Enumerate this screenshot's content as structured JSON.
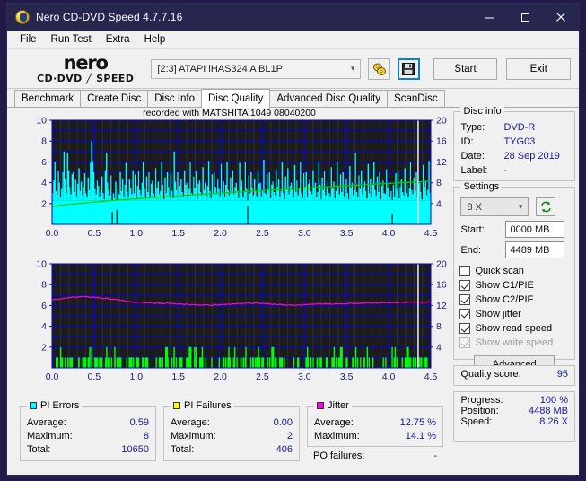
{
  "window": {
    "title": "Nero CD-DVD Speed 4.7.7.16",
    "icon": "nero-disc-icon",
    "minimize": "minimize-icon",
    "maximize": "maximize-icon",
    "close": "close-icon"
  },
  "menu": {
    "items": [
      "File",
      "Run Test",
      "Extra",
      "Help"
    ]
  },
  "toolbar": {
    "logo_line1": "nero",
    "logo_line2": "CD·DVD ╱ SPEED",
    "drive": "[2:3]   ATAPI iHAS324   A BL1P",
    "drive_arrow": "chevron-down-icon",
    "icon_speed": "disc-speed-icon",
    "icon_save": "save-floppy-icon",
    "start_label": "Start",
    "exit_label": "Exit"
  },
  "tabs": [
    {
      "label": "Benchmark",
      "active": false
    },
    {
      "label": "Create Disc",
      "active": false
    },
    {
      "label": "Disc Info",
      "active": false
    },
    {
      "label": "Disc Quality",
      "active": true
    },
    {
      "label": "Advanced Disc Quality",
      "active": false
    },
    {
      "label": "ScanDisc",
      "active": false
    }
  ],
  "chart_header": "recorded with MATSHITA 1049 08040200",
  "disc_info": {
    "legend": "Disc info",
    "rows": [
      {
        "k": "Type:",
        "v": "DVD-R"
      },
      {
        "k": "ID:",
        "v": "TYG03"
      },
      {
        "k": "Date:",
        "v": "28 Sep 2019"
      },
      {
        "k": "Label:",
        "v": "-"
      }
    ]
  },
  "settings": {
    "legend": "Settings",
    "speed": "8 X",
    "speed_arrow": "chevron-down-icon",
    "refresh_icon": "refresh-icon",
    "start_label": "Start:",
    "start_value": "0000 MB",
    "end_label": "End:",
    "end_value": "4489 MB",
    "checkboxes": [
      {
        "label": "Quick scan",
        "checked": false,
        "disabled": false
      },
      {
        "label": "Show C1/PIE",
        "checked": true,
        "disabled": false
      },
      {
        "label": "Show C2/PIF",
        "checked": true,
        "disabled": false
      },
      {
        "label": "Show jitter",
        "checked": true,
        "disabled": false
      },
      {
        "label": "Show read speed",
        "checked": true,
        "disabled": false
      },
      {
        "label": "Show write speed",
        "checked": true,
        "disabled": true
      }
    ],
    "advanced_label": "Advanced"
  },
  "quality": {
    "label": "Quality score:",
    "value": "95"
  },
  "progress": {
    "rows": [
      {
        "k": "Progress:",
        "v": "100 %"
      },
      {
        "k": "Position:",
        "v": "4488 MB"
      },
      {
        "k": "Speed:",
        "v": "8.26 X"
      }
    ]
  },
  "stats": {
    "pi_errors": {
      "legend": "PI Errors",
      "color": "#00ffff",
      "rows": [
        {
          "k": "Average:",
          "v": "0.59"
        },
        {
          "k": "Maximum:",
          "v": "8"
        },
        {
          "k": "Total:",
          "v": "10650"
        }
      ]
    },
    "pi_failures": {
      "legend": "PI Failures",
      "color": "#ffff00",
      "rows": [
        {
          "k": "Average:",
          "v": "0.00"
        },
        {
          "k": "Maximum:",
          "v": "2"
        },
        {
          "k": "Total:",
          "v": "406"
        }
      ]
    },
    "jitter": {
      "legend": "Jitter",
      "color": "#ff00dd",
      "rows": [
        {
          "k": "Average:",
          "v": "12.75 %"
        },
        {
          "k": "Maximum:",
          "v": "14.1 %"
        }
      ],
      "po_label": "PO failures:",
      "po_value": "-"
    }
  },
  "chart_data": [
    {
      "id": "pie-chart",
      "type": "line",
      "title": "recorded with MATSHITA 1049 08040200",
      "xlabel": "",
      "ylabel": "",
      "xlim": [
        0.0,
        4.5
      ],
      "xticks": [
        "0.0",
        "0.5",
        "1.0",
        "1.5",
        "2.0",
        "2.5",
        "3.0",
        "3.5",
        "4.0",
        "4.5"
      ],
      "ylim_left": [
        0,
        10
      ],
      "yticks_left": [
        "2",
        "4",
        "6",
        "8",
        "10"
      ],
      "ylim_right": [
        0,
        20
      ],
      "yticks_right": [
        "4",
        "8",
        "12",
        "16",
        "20"
      ],
      "grid": true,
      "background": "#1c1c1c",
      "grid_color": "#0000ee",
      "series": [
        {
          "name": "PI Errors",
          "color": "#00ffff",
          "axis": "left",
          "style": "filled-spikes",
          "baseline": 2.3,
          "average": 0.59,
          "maximum": 8,
          "total": 10650,
          "values": [
            3.0,
            4.2,
            6.0,
            3.2,
            2.8,
            5.1,
            4.0,
            2.6,
            3.4,
            5.0,
            7.0,
            4.4,
            3.0,
            6.9,
            5.2,
            3.6,
            2.9,
            4.8,
            5.0,
            3.1,
            4.3,
            2.7,
            3.9,
            5.4,
            3.2,
            4.1,
            2.8,
            3.6,
            4.9,
            3.0,
            2.6,
            4.5,
            3.3,
            5.9,
            8.0,
            6.1,
            5.0,
            3.4,
            2.9,
            4.2,
            3.7,
            2.6,
            3.1,
            4.6,
            3.0,
            2.4,
            5.2,
            6.9,
            4.0,
            3.3,
            2.8,
            4.7,
            1.2,
            3.0,
            2.5,
            4.1,
            1.4,
            3.6,
            2.9,
            5.0,
            3.2,
            4.4,
            2.7,
            3.8,
            5.9,
            3.1,
            2.6,
            4.3,
            3.5,
            2.9,
            5.2,
            3.0,
            4.8,
            2.4,
            3.7,
            5.1,
            3.3,
            2.8,
            4.0,
            6.0,
            3.4,
            2.5,
            4.6,
            3.1,
            5.0,
            2.7,
            3.9,
            4.2,
            3.0,
            2.6,
            5.4,
            3.5,
            4.1,
            2.9,
            3.2,
            6.0,
            3.8,
            2.4,
            4.5,
            3.0,
            5.0,
            3.6,
            2.8,
            4.9,
            3.2,
            2.5,
            7.0,
            4.1,
            3.3,
            5.0,
            2.9,
            3.7,
            4.4,
            3.1,
            2.6,
            5.2,
            3.8,
            4.0,
            2.7,
            3.4,
            6.0,
            3.0,
            2.9,
            4.6,
            3.5,
            5.1,
            2.4,
            3.9,
            4.2,
            3.1,
            2.8,
            5.5,
            3.3,
            4.0,
            2.6,
            3.7,
            6.1,
            3.2,
            2.5,
            4.8,
            3.0,
            5.0,
            3.6,
            2.9,
            4.3,
            3.4,
            2.7,
            5.8,
            3.1,
            4.1,
            2.6,
            3.8,
            6.0,
            3.3,
            2.8,
            4.5,
            3.0,
            5.2,
            2.9,
            3.6,
            4.0,
            3.2,
            2.5,
            5.9,
            3.7,
            4.2,
            2.6,
            3.1,
            6.0,
            3.4,
            1.8,
            4.7,
            3.0,
            5.0,
            3.5,
            2.8,
            4.4,
            3.2,
            2.7,
            5.1,
            3.9,
            4.0,
            2.6,
            3.3,
            6.2,
            3.0,
            2.9,
            4.8,
            3.4,
            5.0,
            2.5,
            3.8,
            4.1,
            3.1,
            2.8,
            5.3,
            3.6,
            4.3,
            2.6,
            3.2,
            6.0,
            3.0,
            2.4,
            4.6,
            3.5,
            5.4,
            2.9,
            3.7,
            4.0,
            3.3,
            2.6,
            5.7,
            3.1,
            4.2,
            2.8,
            3.4,
            6.0,
            3.0,
            2.5,
            4.9,
            3.6,
            5.0,
            2.7,
            3.9,
            4.4,
            3.2,
            2.9,
            5.2,
            3.5,
            4.0,
            2.6,
            3.1,
            5.9,
            3.8,
            2.4,
            4.5,
            3.3,
            5.1,
            2.8,
            3.6,
            4.2,
            3.0,
            2.7,
            5.5,
            3.4,
            4.1,
            2.5,
            3.2,
            6.0,
            3.7,
            2.9,
            4.8,
            3.1,
            5.0,
            2.6,
            3.8,
            4.3,
            3.0,
            2.4,
            5.6,
            3.5,
            4.0,
            2.8,
            3.3,
            6.9,
            3.1,
            2.6,
            4.7,
            3.4,
            5.2,
            2.9,
            3.6,
            4.1,
            3.2,
            2.5,
            5.8,
            3.0,
            4.4,
            2.7,
            3.9,
            6.0,
            3.3,
            2.8,
            4.6,
            3.1,
            5.0,
            2.4,
            3.7,
            4.2,
            3.0,
            2.9,
            5.3,
            3.5,
            4.0,
            2.6,
            3.2,
            1.0,
            3.8,
            2.7,
            4.9,
            3.4,
            5.1,
            2.5,
            3.6,
            4.3,
            3.1,
            2.8,
            5.4,
            3.0,
            4.1,
            2.6,
            3.5,
            6.0,
            3.3,
            2.9,
            4.5,
            3.2,
            5.0,
            2.7,
            3.9,
            4.0,
            3.1,
            2.4,
            5.7,
            3.6,
            4.2,
            2.8,
            3.3,
            6.1,
            3.0,
            2.6,
            4.8,
            3.4,
            5.2,
            2.9,
            3.7,
            4.4,
            3.2,
            2.5,
            5.9,
            3.1,
            4.0,
            2.7,
            3.8,
            3.5,
            3.0
          ]
        },
        {
          "name": "Read speed",
          "color": "#00cc00",
          "axis": "right",
          "style": "line",
          "start_value": 3.4,
          "end_value": 8.3,
          "description": "monotonic rising CAV read-speed curve from about 3.4X to 8.3X"
        }
      ]
    },
    {
      "id": "pif-jitter-chart",
      "type": "line",
      "title": "",
      "xlabel": "",
      "ylabel": "",
      "xlim": [
        0.0,
        4.5
      ],
      "xticks": [
        "0.0",
        "0.5",
        "1.0",
        "1.5",
        "2.0",
        "2.5",
        "3.0",
        "3.5",
        "4.0",
        "4.5"
      ],
      "ylim_left": [
        0,
        10
      ],
      "yticks_left": [
        "2",
        "4",
        "6",
        "8",
        "10"
      ],
      "ylim_right": [
        0,
        20
      ],
      "yticks_right": [
        "4",
        "8",
        "12",
        "16",
        "20"
      ],
      "grid": true,
      "background": "#1c1c1c",
      "grid_color": "#0000ee",
      "series": [
        {
          "name": "PI Failures",
          "color": "#00ff00",
          "axis": "left",
          "style": "spikes",
          "average": 0.0,
          "maximum": 2,
          "total": 406,
          "description": "sparse green spikes of height 1 with occasional height 2"
        },
        {
          "name": "Jitter",
          "color": "#ff00dd",
          "axis": "right",
          "style": "line",
          "average": 12.75,
          "maximum": 14.1,
          "description": "magenta jitter trace near 13.3% for 0.0-1.2 GB then stepping down to about 12.3% and drifting to 12.4% at the end"
        }
      ]
    }
  ]
}
